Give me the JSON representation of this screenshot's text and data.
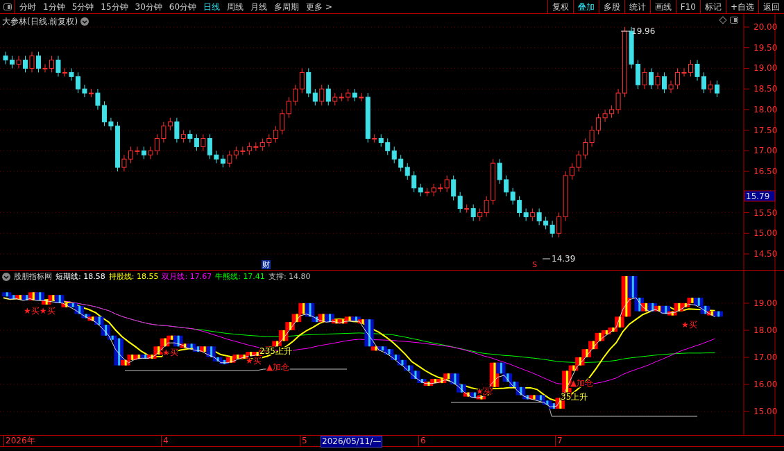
{
  "toolbar": {
    "periods": [
      {
        "label": "分时",
        "selected": false
      },
      {
        "label": "1分钟",
        "selected": false
      },
      {
        "label": "5分钟",
        "selected": false
      },
      {
        "label": "15分钟",
        "selected": false
      },
      {
        "label": "30分钟",
        "selected": false
      },
      {
        "label": "60分钟",
        "selected": false
      },
      {
        "label": "日线",
        "selected": true
      },
      {
        "label": "周线",
        "selected": false
      },
      {
        "label": "月线",
        "selected": false
      },
      {
        "label": "多周期",
        "selected": false
      },
      {
        "label": "更多 >",
        "selected": false
      }
    ],
    "actions": [
      {
        "label": "复权",
        "selected": false
      },
      {
        "label": "叠加",
        "selected": true
      },
      {
        "label": "多股",
        "selected": false
      },
      {
        "label": "统计",
        "selected": false
      },
      {
        "label": "画线",
        "selected": false
      },
      {
        "label": "F10",
        "selected": false
      },
      {
        "label": "标记",
        "selected": false
      },
      {
        "label": "+自选",
        "selected": false
      },
      {
        "label": "返回",
        "selected": false
      }
    ]
  },
  "main_chart": {
    "title": "大参林(日线.前复权)",
    "y_axis": [
      "20.00",
      "19.50",
      "19.00",
      "18.50",
      "18.00",
      "17.50",
      "17.00",
      "16.50",
      "15.50",
      "15.00",
      "14.50"
    ],
    "current_price": "15.79",
    "high_label": "19.96",
    "low_label": "14.39",
    "finance_marker": "财",
    "signal_marker": "S"
  },
  "indicator": {
    "name": "股朋指标网",
    "values": [
      {
        "label": "短期线:",
        "value": "18.58",
        "color": "#ffffff"
      },
      {
        "label": "持股线:",
        "value": "18.55",
        "color": "#ffff00"
      },
      {
        "label": "双月线:",
        "value": "17.67",
        "color": "#ff00ff"
      },
      {
        "label": "牛熊线:",
        "value": "17.41",
        "color": "#00ff00"
      },
      {
        "label": "支撑:",
        "value": "14.80",
        "color": "#c0c0c0"
      }
    ],
    "y_axis": [
      "19.00",
      "18.00",
      "17.00",
      "16.00",
      "15.00"
    ],
    "signals": [
      {
        "text": "★买★买",
        "kind": "buy"
      },
      {
        "text": "★买",
        "kind": "buy"
      },
      {
        "text": "★买",
        "kind": "buy"
      },
      {
        "text": "235上升",
        "kind": "rise"
      },
      {
        "text": "▲加仓",
        "kind": "add"
      },
      {
        "text": "★买",
        "kind": "buy"
      },
      {
        "text": "▲加仓",
        "kind": "add"
      },
      {
        "text": "35上升",
        "kind": "rise"
      },
      {
        "text": "★买",
        "kind": "buy"
      }
    ]
  },
  "date_axis": [
    {
      "label": "2026年",
      "selected": false
    },
    {
      "label": "4",
      "selected": false
    },
    {
      "label": "5",
      "selected": false
    },
    {
      "label": "2026/05/11/—",
      "selected": true
    },
    {
      "label": "6",
      "selected": false
    },
    {
      "label": "7",
      "selected": false
    }
  ]
}
